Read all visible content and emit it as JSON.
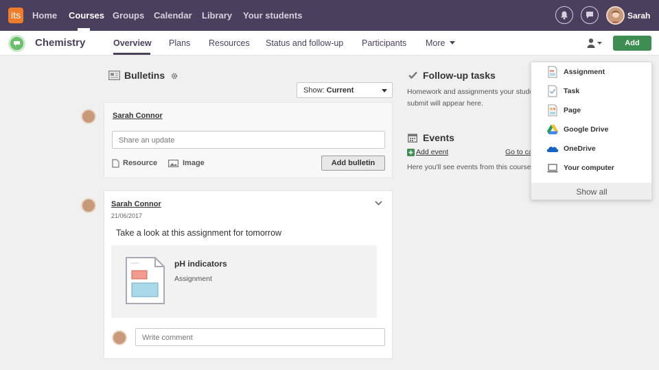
{
  "topnav": {
    "logo": "its",
    "items": [
      "Home",
      "Courses",
      "Groups",
      "Calendar",
      "Library",
      "Your students"
    ],
    "user": "Sarah"
  },
  "course": {
    "title": "Chemistry",
    "tabs": [
      "Overview",
      "Plans",
      "Resources",
      "Status and follow-up",
      "Participants",
      "More"
    ],
    "add_label": "Add"
  },
  "bulletins": {
    "title": "Bulletins",
    "show_label": "Show:",
    "show_value": "Current",
    "composer": {
      "author": "Sarah Connor",
      "placeholder": "Share an update",
      "resource_label": "Resource",
      "image_label": "Image",
      "submit_label": "Add bulletin"
    },
    "post": {
      "author": "Sarah Connor",
      "date": "21/06/2017",
      "text": "Take a look at this assignment for tomorrow",
      "attachment_title": "pH indicators",
      "attachment_type": "Assignment",
      "comment_placeholder": "Write comment"
    }
  },
  "followup": {
    "title": "Follow-up tasks",
    "line1": "Homework and assignments your stude",
    "line2": "submit will appear here."
  },
  "events": {
    "title": "Events",
    "add_link": "Add event",
    "goto_link": "Go to ca",
    "text": "Here you'll see events from this course."
  },
  "add_menu": {
    "items": [
      "Assignment",
      "Task",
      "Page",
      "Google Drive",
      "OneDrive",
      "Your computer"
    ],
    "show_all": "Show all"
  },
  "colors": {
    "nav_bg": "#4a3f5c",
    "accent_green": "#3e8e54",
    "logo_orange": "#f07c2b"
  }
}
